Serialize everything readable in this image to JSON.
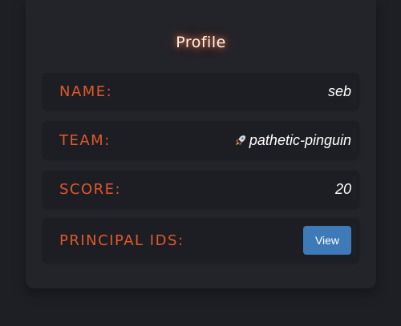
{
  "profile": {
    "title": "Profile",
    "name_label": "NAME:",
    "name_value": "seb",
    "team_label": "TEAM:",
    "team_icon": "rocket-icon",
    "team_value": "pathetic-pinguin",
    "score_label": "SCORE:",
    "score_value": "20",
    "principal_ids_label": "PRINCIPAL IDS:",
    "view_button_label": "View"
  },
  "colors": {
    "background": "#1e1f24",
    "card": "#23242a",
    "row": "#1d1e23",
    "label": "#e0582c",
    "button": "#3d7ab7",
    "title_glow": "#ff8246"
  }
}
